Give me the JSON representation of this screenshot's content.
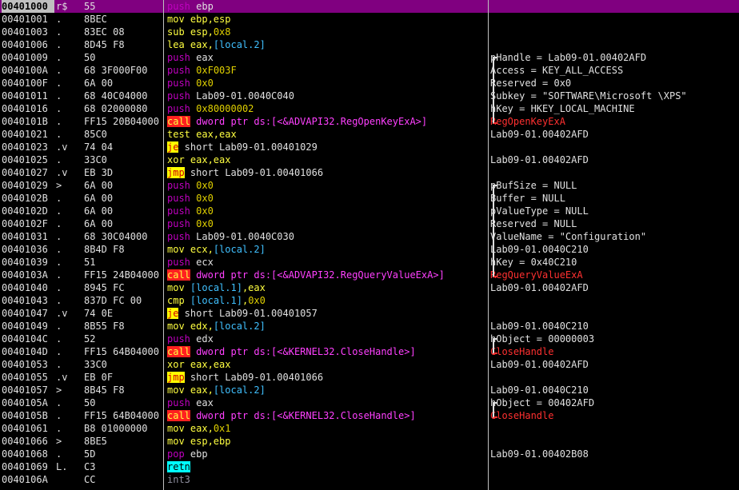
{
  "rows": [
    {
      "addr": "00401000",
      "mark": "r$",
      "hex": "55",
      "asm": [
        [
          "push",
          "t-push"
        ],
        [
          " ",
          ""
        ],
        [
          "ebp",
          "t-white"
        ]
      ],
      "cmt": "",
      "sel": true
    },
    {
      "addr": "00401001",
      "mark": ".",
      "hex": "8BEC",
      "asm": [
        [
          "mov",
          "t-mnem"
        ],
        [
          " ebp,esp",
          "t-mnem"
        ]
      ],
      "cmt": ""
    },
    {
      "addr": "00401003",
      "mark": ".",
      "hex": "83EC 08",
      "asm": [
        [
          "sub",
          "t-mnem"
        ],
        [
          " esp,",
          "t-mnem"
        ],
        [
          "0x8",
          "t-num"
        ]
      ],
      "cmt": ""
    },
    {
      "addr": "00401006",
      "mark": ".",
      "hex": "8D45 F8",
      "asm": [
        [
          "lea",
          "t-mnem"
        ],
        [
          " eax,",
          "t-mnem"
        ],
        [
          "[local.2]",
          "t-reg"
        ]
      ],
      "cmt": ""
    },
    {
      "addr": "00401009",
      "mark": ".",
      "hex": "50",
      "asm": [
        [
          "push",
          "t-push"
        ],
        [
          " ",
          ""
        ],
        [
          "eax",
          "t-white"
        ]
      ],
      "cmt": "pHandle = Lab09-01.00402AFD"
    },
    {
      "addr": "0040100A",
      "mark": ".",
      "hex": "68 3F000F00",
      "asm": [
        [
          "push",
          "t-push"
        ],
        [
          " ",
          ""
        ],
        [
          "0xF003F",
          "t-num"
        ]
      ],
      "cmt": "Access = KEY_ALL_ACCESS"
    },
    {
      "addr": "0040100F",
      "mark": ".",
      "hex": "6A 00",
      "asm": [
        [
          "push",
          "t-push"
        ],
        [
          " ",
          ""
        ],
        [
          "0x0",
          "t-num"
        ]
      ],
      "cmt": "Reserved = 0x0"
    },
    {
      "addr": "00401011",
      "mark": ".",
      "hex": "68 40C04000",
      "asm": [
        [
          "push",
          "t-push"
        ],
        [
          " ",
          ""
        ],
        [
          "Lab09-01.0040C040",
          "t-white"
        ]
      ],
      "cmt": "Subkey = \"SOFTWARE\\Microsoft \\XPS\""
    },
    {
      "addr": "00401016",
      "mark": ".",
      "hex": "68 02000080",
      "asm": [
        [
          "push",
          "t-push"
        ],
        [
          " ",
          ""
        ],
        [
          "0x80000002",
          "t-num"
        ]
      ],
      "cmt": "hKey = HKEY_LOCAL_MACHINE"
    },
    {
      "addr": "0040101B",
      "mark": ".",
      "hex": "FF15 20B04000",
      "asm": [
        [
          "call",
          "t-call"
        ],
        [
          " dword ptr ds:[<&ADVAPI32.RegOpenKeyExA>]",
          "t-mag"
        ]
      ],
      "cmt": "RegOpenKeyExA",
      "cmtRed": true
    },
    {
      "addr": "00401021",
      "mark": ".",
      "hex": "85C0",
      "asm": [
        [
          "test",
          "t-mnem"
        ],
        [
          " eax,eax",
          "t-mnem"
        ]
      ],
      "cmt": "Lab09-01.00402AFD"
    },
    {
      "addr": "00401023",
      "mark": ".v",
      "hex": "74 04",
      "asm": [
        [
          "je",
          "t-jmp"
        ],
        [
          " short Lab09-01.00401029",
          "t-white"
        ]
      ],
      "cmt": ""
    },
    {
      "addr": "00401025",
      "mark": ".",
      "hex": "33C0",
      "asm": [
        [
          "xor",
          "t-mnem"
        ],
        [
          " eax,eax",
          "t-mnem"
        ]
      ],
      "cmt": "Lab09-01.00402AFD"
    },
    {
      "addr": "00401027",
      "mark": ".v",
      "hex": "EB 3D",
      "asm": [
        [
          "jmp",
          "t-jmp"
        ],
        [
          " short Lab09-01.00401066",
          "t-white"
        ]
      ],
      "cmt": ""
    },
    {
      "addr": "00401029",
      "mark": ">",
      "hex": "6A 00",
      "asm": [
        [
          "push",
          "t-push"
        ],
        [
          " ",
          ""
        ],
        [
          "0x0",
          "t-num"
        ]
      ],
      "cmt": "pBufSize = NULL"
    },
    {
      "addr": "0040102B",
      "mark": ".",
      "hex": "6A 00",
      "asm": [
        [
          "push",
          "t-push"
        ],
        [
          " ",
          ""
        ],
        [
          "0x0",
          "t-num"
        ]
      ],
      "cmt": "Buffer = NULL"
    },
    {
      "addr": "0040102D",
      "mark": ".",
      "hex": "6A 00",
      "asm": [
        [
          "push",
          "t-push"
        ],
        [
          " ",
          ""
        ],
        [
          "0x0",
          "t-num"
        ]
      ],
      "cmt": "pValueType = NULL"
    },
    {
      "addr": "0040102F",
      "mark": ".",
      "hex": "6A 00",
      "asm": [
        [
          "push",
          "t-push"
        ],
        [
          " ",
          ""
        ],
        [
          "0x0",
          "t-num"
        ]
      ],
      "cmt": "Reserved = NULL"
    },
    {
      "addr": "00401031",
      "mark": ".",
      "hex": "68 30C04000",
      "asm": [
        [
          "push",
          "t-push"
        ],
        [
          " ",
          ""
        ],
        [
          "Lab09-01.0040C030",
          "t-white"
        ]
      ],
      "cmt": "ValueName = \"Configuration\""
    },
    {
      "addr": "00401036",
      "mark": ".",
      "hex": "8B4D F8",
      "asm": [
        [
          "mov",
          "t-mnem"
        ],
        [
          " ecx,",
          "t-mnem"
        ],
        [
          "[local.2]",
          "t-reg"
        ]
      ],
      "cmt": "Lab09-01.0040C210"
    },
    {
      "addr": "00401039",
      "mark": ".",
      "hex": "51",
      "asm": [
        [
          "push",
          "t-push"
        ],
        [
          " ",
          ""
        ],
        [
          "ecx",
          "t-white"
        ]
      ],
      "cmt": "hKey = 0x40C210"
    },
    {
      "addr": "0040103A",
      "mark": ".",
      "hex": "FF15 24B04000",
      "asm": [
        [
          "call",
          "t-call"
        ],
        [
          " dword ptr ds:[<&ADVAPI32.RegQueryValueExA>]",
          "t-mag"
        ]
      ],
      "cmt": "RegQueryValueExA",
      "cmtRed": true
    },
    {
      "addr": "00401040",
      "mark": ".",
      "hex": "8945 FC",
      "asm": [
        [
          "mov",
          "t-mnem"
        ],
        [
          " ",
          "t-mnem"
        ],
        [
          "[local.1]",
          "t-reg"
        ],
        [
          ",eax",
          "t-mnem"
        ]
      ],
      "cmt": "Lab09-01.00402AFD"
    },
    {
      "addr": "00401043",
      "mark": ".",
      "hex": "837D FC 00",
      "asm": [
        [
          "cmp",
          "t-mnem"
        ],
        [
          " ",
          "t-mnem"
        ],
        [
          "[local.1]",
          "t-reg"
        ],
        [
          ",",
          "t-mnem"
        ],
        [
          "0x0",
          "t-num"
        ]
      ],
      "cmt": ""
    },
    {
      "addr": "00401047",
      "mark": ".v",
      "hex": "74 0E",
      "asm": [
        [
          "je",
          "t-jmp"
        ],
        [
          " short Lab09-01.00401057",
          "t-white"
        ]
      ],
      "cmt": ""
    },
    {
      "addr": "00401049",
      "mark": ".",
      "hex": "8B55 F8",
      "asm": [
        [
          "mov",
          "t-mnem"
        ],
        [
          " edx,",
          "t-mnem"
        ],
        [
          "[local.2]",
          "t-reg"
        ]
      ],
      "cmt": "Lab09-01.0040C210"
    },
    {
      "addr": "0040104C",
      "mark": ".",
      "hex": "52",
      "asm": [
        [
          "push",
          "t-push"
        ],
        [
          " ",
          ""
        ],
        [
          "edx",
          "t-white"
        ]
      ],
      "cmt": "hObject = 00000003"
    },
    {
      "addr": "0040104D",
      "mark": ".",
      "hex": "FF15 64B04000",
      "asm": [
        [
          "call",
          "t-call"
        ],
        [
          " dword ptr ds:[<&KERNEL32.CloseHandle>]",
          "t-mag"
        ]
      ],
      "cmt": "CloseHandle",
      "cmtRed": true
    },
    {
      "addr": "00401053",
      "mark": ".",
      "hex": "33C0",
      "asm": [
        [
          "xor",
          "t-mnem"
        ],
        [
          " eax,eax",
          "t-mnem"
        ]
      ],
      "cmt": "Lab09-01.00402AFD"
    },
    {
      "addr": "00401055",
      "mark": ".v",
      "hex": "EB 0F",
      "asm": [
        [
          "jmp",
          "t-jmp"
        ],
        [
          " short Lab09-01.00401066",
          "t-white"
        ]
      ],
      "cmt": ""
    },
    {
      "addr": "00401057",
      "mark": ">",
      "hex": "8B45 F8",
      "asm": [
        [
          "mov",
          "t-mnem"
        ],
        [
          " eax,",
          "t-mnem"
        ],
        [
          "[local.2]",
          "t-reg"
        ]
      ],
      "cmt": "Lab09-01.0040C210"
    },
    {
      "addr": "0040105A",
      "mark": ".",
      "hex": "50",
      "asm": [
        [
          "push",
          "t-push"
        ],
        [
          " ",
          ""
        ],
        [
          "eax",
          "t-white"
        ]
      ],
      "cmt": "hObject = 00402AFD"
    },
    {
      "addr": "0040105B",
      "mark": ".",
      "hex": "FF15 64B04000",
      "asm": [
        [
          "call",
          "t-call"
        ],
        [
          " dword ptr ds:[<&KERNEL32.CloseHandle>]",
          "t-mag"
        ]
      ],
      "cmt": "CloseHandle",
      "cmtRed": true
    },
    {
      "addr": "00401061",
      "mark": ".",
      "hex": "B8 01000000",
      "asm": [
        [
          "mov",
          "t-mnem"
        ],
        [
          " eax,",
          "t-mnem"
        ],
        [
          "0x1",
          "t-num"
        ]
      ],
      "cmt": ""
    },
    {
      "addr": "00401066",
      "mark": ">",
      "hex": "8BE5",
      "asm": [
        [
          "mov",
          "t-mnem"
        ],
        [
          " esp,ebp",
          "t-mnem"
        ]
      ],
      "cmt": ""
    },
    {
      "addr": "00401068",
      "mark": ".",
      "hex": "5D",
      "asm": [
        [
          "pop",
          "t-push"
        ],
        [
          " ",
          ""
        ],
        [
          "ebp",
          "t-white"
        ]
      ],
      "cmt": "Lab09-01.00402B08"
    },
    {
      "addr": "00401069",
      "mark": "L.",
      "hex": "C3",
      "asm": [
        [
          "retn",
          "t-ret"
        ]
      ],
      "cmt": ""
    },
    {
      "addr": "0040106A",
      "mark": "",
      "hex": "CC",
      "asm": [
        [
          "int3",
          "t-grey"
        ]
      ],
      "cmt": ""
    }
  ]
}
